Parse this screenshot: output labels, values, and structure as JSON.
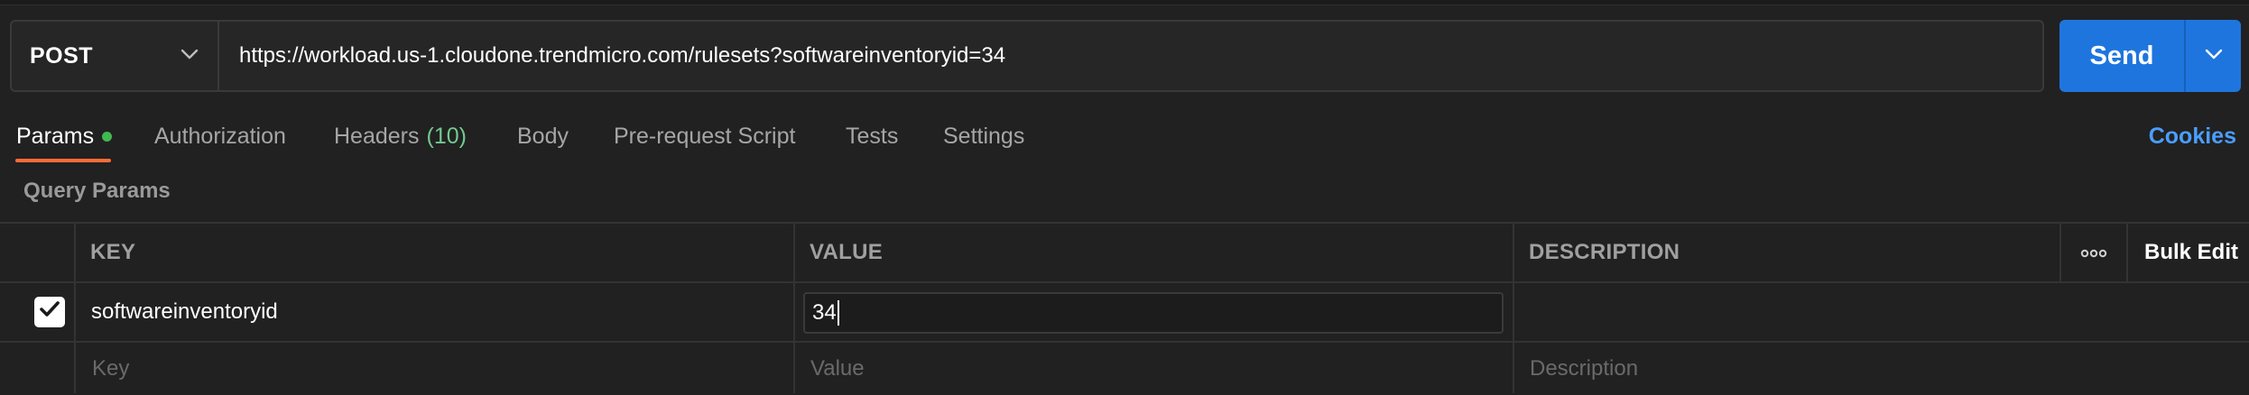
{
  "request": {
    "method": "POST",
    "url": "https://workload.us-1.cloudone.trendmicro.com/rulesets?softwareinventoryid=34",
    "send_label": "Send"
  },
  "tabs": [
    {
      "label": "Params",
      "active": true,
      "indicator_dot": true
    },
    {
      "label": "Authorization"
    },
    {
      "label": "Headers",
      "count": "(10)"
    },
    {
      "label": "Body"
    },
    {
      "label": "Pre-request Script"
    },
    {
      "label": "Tests"
    },
    {
      "label": "Settings"
    }
  ],
  "cookies_label": "Cookies",
  "section_title": "Query Params",
  "table": {
    "headers": {
      "key": "KEY",
      "value": "VALUE",
      "description": "DESCRIPTION",
      "more": "∘∘∘",
      "bulk_edit": "Bulk Edit"
    },
    "rows": [
      {
        "checked": true,
        "key": "softwareinventoryid",
        "value": "34",
        "description": ""
      }
    ],
    "placeholders": {
      "key": "Key",
      "value": "Value",
      "description": "Description"
    }
  },
  "colors": {
    "accent_orange": "#ff6c37",
    "send_blue": "#1f75de",
    "link_blue": "#4a9eff",
    "status_green": "#3fb950"
  },
  "icons": {
    "method_dropdown": "chevron-down-icon",
    "send_dropdown": "chevron-down-icon",
    "checkbox": "checkmark-icon"
  }
}
